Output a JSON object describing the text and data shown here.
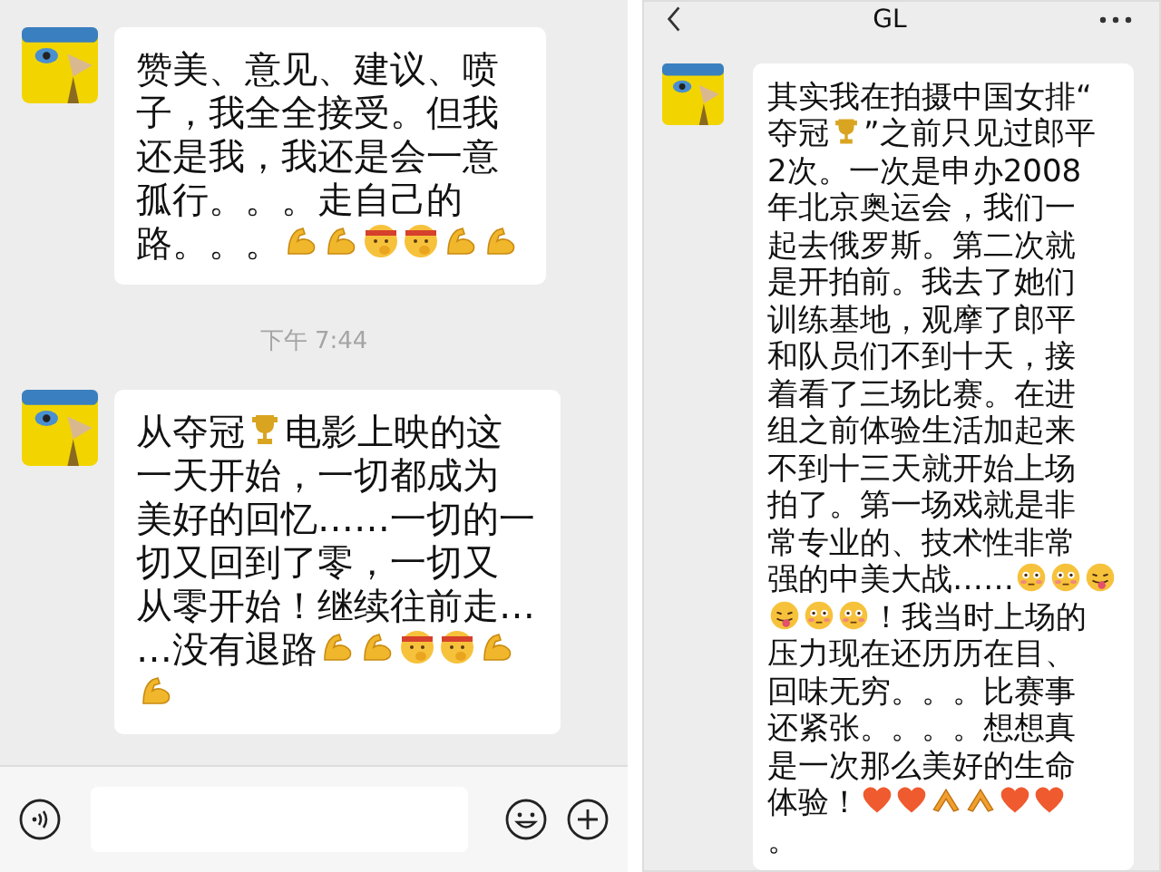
{
  "left_chat": {
    "items": [
      {
        "kind": "message",
        "lines": [
          [
            {
              "kind": "text",
              "text": "赞美、意见、建议、喷"
            }
          ],
          [
            {
              "kind": "text",
              "text": "子，我全全接受。但我"
            }
          ],
          [
            {
              "kind": "text",
              "text": "还是我，我还是会一意"
            }
          ],
          [
            {
              "kind": "text",
              "text": "孤行。。。走自己的"
            }
          ],
          [
            {
              "kind": "text",
              "text": "路。。。"
            },
            {
              "kind": "muscle"
            },
            {
              "kind": "muscle"
            },
            {
              "kind": "fighter"
            },
            {
              "kind": "fighter"
            },
            {
              "kind": "muscle"
            },
            {
              "kind": "muscle"
            }
          ]
        ]
      },
      {
        "kind": "time",
        "text": "下午 7:44"
      },
      {
        "kind": "message",
        "lines": [
          [
            {
              "kind": "text",
              "text": "从夺冠"
            },
            {
              "kind": "trophy"
            },
            {
              "kind": "text",
              "text": "电影上映的这"
            }
          ],
          [
            {
              "kind": "text",
              "text": "一天开始，一切都成为"
            }
          ],
          [
            {
              "kind": "text",
              "text": "美好的回忆……一切的一"
            }
          ],
          [
            {
              "kind": "text",
              "text": "切又回到了零，一切又"
            }
          ],
          [
            {
              "kind": "text",
              "text": "从零开始！继续往前走…"
            }
          ],
          [
            {
              "kind": "text",
              "text": "…没有退路"
            },
            {
              "kind": "muscle"
            },
            {
              "kind": "muscle"
            },
            {
              "kind": "fighter"
            },
            {
              "kind": "fighter"
            },
            {
              "kind": "muscle"
            }
          ],
          [
            {
              "kind": "muscle"
            }
          ]
        ]
      }
    ]
  },
  "right_chat": {
    "title": "GL",
    "items": [
      {
        "kind": "message",
        "lines": [
          [
            {
              "kind": "text",
              "text": "其实我在拍摄中国女排“"
            }
          ],
          [
            {
              "kind": "text",
              "text": "夺冠"
            },
            {
              "kind": "trophy"
            },
            {
              "kind": "text",
              "text": "”之前只见过郎平"
            }
          ],
          [
            {
              "kind": "text",
              "text": "2次。一次是申办2008"
            }
          ],
          [
            {
              "kind": "text",
              "text": "年北京奥运会，我们一"
            }
          ],
          [
            {
              "kind": "text",
              "text": "起去俄罗斯。第二次就"
            }
          ],
          [
            {
              "kind": "text",
              "text": "是开拍前。我去了她们"
            }
          ],
          [
            {
              "kind": "text",
              "text": "训练基地，观摩了郎平"
            }
          ],
          [
            {
              "kind": "text",
              "text": "和队员们不到十天，接"
            }
          ],
          [
            {
              "kind": "text",
              "text": "着看了三场比赛。在进"
            }
          ],
          [
            {
              "kind": "text",
              "text": "组之前体验生活加起来"
            }
          ],
          [
            {
              "kind": "text",
              "text": "不到十三天就开始上场"
            }
          ],
          [
            {
              "kind": "text",
              "text": "拍了。第一场戏就是非"
            }
          ],
          [
            {
              "kind": "text",
              "text": "常专业的、技术性非常"
            }
          ],
          [
            {
              "kind": "text",
              "text": "强的中美大战……"
            },
            {
              "kind": "flushed"
            },
            {
              "kind": "flushed"
            },
            {
              "kind": "tongue"
            }
          ],
          [
            {
              "kind": "tongue"
            },
            {
              "kind": "flushed"
            },
            {
              "kind": "flushed"
            },
            {
              "kind": "text",
              "text": "！我当时上场的"
            }
          ],
          [
            {
              "kind": "text",
              "text": "压力现在还历历在目、"
            }
          ],
          [
            {
              "kind": "text",
              "text": "回味无穷。。。比赛事"
            }
          ],
          [
            {
              "kind": "text",
              "text": "还紧张。。。。想想真"
            }
          ],
          [
            {
              "kind": "text",
              "text": "是一次那么美好的生命"
            }
          ],
          [
            {
              "kind": "text",
              "text": "体验！"
            },
            {
              "kind": "heart"
            },
            {
              "kind": "heart"
            },
            {
              "kind": "hands"
            },
            {
              "kind": "hands"
            },
            {
              "kind": "heart"
            },
            {
              "kind": "heart"
            }
          ],
          [
            {
              "kind": "text",
              "text": "。"
            }
          ]
        ]
      }
    ]
  }
}
